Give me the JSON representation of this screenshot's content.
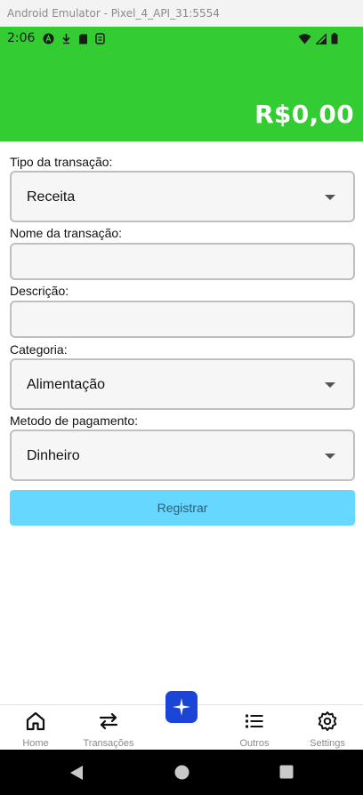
{
  "emulator": {
    "title": "Android Emulator - Pixel_4_API_31:5554"
  },
  "status_bar": {
    "time": "2:06"
  },
  "header": {
    "balance": "R$0,00",
    "color": "#33cc33"
  },
  "form": {
    "transaction_type": {
      "label": "Tipo da transação:",
      "value": "Receita"
    },
    "transaction_name": {
      "label": "Nome da transação:",
      "value": ""
    },
    "description": {
      "label": "Descrição:",
      "value": ""
    },
    "category": {
      "label": "Categoria:",
      "value": "Alimentação"
    },
    "payment_method": {
      "label": "Metodo de pagamento:",
      "value": "Dinheiro"
    },
    "submit_label": "Registrar"
  },
  "bottom_nav": {
    "items": [
      {
        "label": "Home",
        "icon": "home-icon"
      },
      {
        "label": "Transações",
        "icon": "transfer-icon"
      },
      {
        "label": "",
        "icon": "plus-icon"
      },
      {
        "label": "Outros",
        "icon": "list-icon"
      },
      {
        "label": "Settings",
        "icon": "gear-icon"
      }
    ]
  },
  "colors": {
    "accent": "#33cc33",
    "button": "#66d8ff",
    "fab": "#1a45d6"
  }
}
